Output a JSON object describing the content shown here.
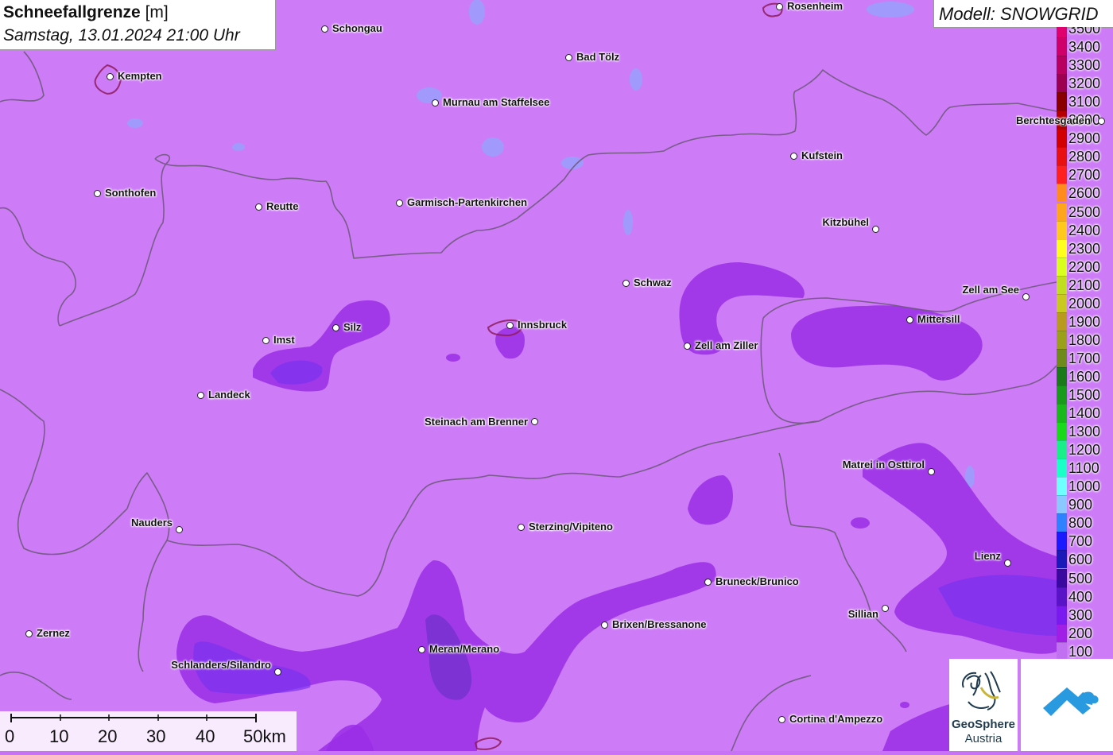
{
  "header": {
    "title_bold": "Schneefallgrenze",
    "title_unit": "[m]",
    "datetime": "Samstag, 13.01.2024 21:00 Uhr"
  },
  "model": {
    "label": "Modell: SNOWGRID"
  },
  "legend": {
    "items": [
      {
        "value": "3500",
        "color": "#e0006e"
      },
      {
        "value": "3400",
        "color": "#d0006a"
      },
      {
        "value": "3300",
        "color": "#b80060"
      },
      {
        "value": "3200",
        "color": "#9c0050"
      },
      {
        "value": "3100",
        "color": "#8a0000"
      },
      {
        "value": "3000",
        "color": "#b40000"
      },
      {
        "value": "2900",
        "color": "#d20000"
      },
      {
        "value": "2800",
        "color": "#e81010"
      },
      {
        "value": "2700",
        "color": "#ff2020"
      },
      {
        "value": "2600",
        "color": "#ff8a1e"
      },
      {
        "value": "2500",
        "color": "#ffa51c"
      },
      {
        "value": "2400",
        "color": "#ffc81c"
      },
      {
        "value": "2300",
        "color": "#ffff1e"
      },
      {
        "value": "2200",
        "color": "#d8ff1e"
      },
      {
        "value": "2100",
        "color": "#c0de1e"
      },
      {
        "value": "2000",
        "color": "#c8c81e"
      },
      {
        "value": "1900",
        "color": "#b89a1e"
      },
      {
        "value": "1800",
        "color": "#9aa01a"
      },
      {
        "value": "1700",
        "color": "#6e8a1a"
      },
      {
        "value": "1600",
        "color": "#1a7a1a"
      },
      {
        "value": "1500",
        "color": "#1a9a1a"
      },
      {
        "value": "1400",
        "color": "#1ab81a"
      },
      {
        "value": "1300",
        "color": "#1ad81a"
      },
      {
        "value": "1200",
        "color": "#1aee8a"
      },
      {
        "value": "1100",
        "color": "#1affc8"
      },
      {
        "value": "1000",
        "color": "#6effff"
      },
      {
        "value": "900",
        "color": "#8ac8ff"
      },
      {
        "value": "800",
        "color": "#2e82ff"
      },
      {
        "value": "700",
        "color": "#1a1aff"
      },
      {
        "value": "600",
        "color": "#1a1ab8"
      },
      {
        "value": "500",
        "color": "#3a0aa0"
      },
      {
        "value": "400",
        "color": "#5a14c8"
      },
      {
        "value": "300",
        "color": "#7a1af0"
      },
      {
        "value": "200",
        "color": "#a01ee6"
      },
      {
        "value": "100",
        "color": "#c070f0"
      }
    ]
  },
  "cities": [
    {
      "name": "Schongau"
    },
    {
      "name": "Rosenheim"
    },
    {
      "name": "Bad Tölz"
    },
    {
      "name": "Kempten"
    },
    {
      "name": "Murnau am Staffelsee"
    },
    {
      "name": "Berchtesgaden"
    },
    {
      "name": "Kufstein"
    },
    {
      "name": "Sonthofen"
    },
    {
      "name": "Reutte"
    },
    {
      "name": "Garmisch-Partenkirchen"
    },
    {
      "name": "Kitzbühel"
    },
    {
      "name": "Schwaz"
    },
    {
      "name": "Zell am See"
    },
    {
      "name": "Mittersill"
    },
    {
      "name": "Innsbruck"
    },
    {
      "name": "Silz"
    },
    {
      "name": "Imst"
    },
    {
      "name": "Zell am Ziller"
    },
    {
      "name": "Landeck"
    },
    {
      "name": "Steinach am Brenner"
    },
    {
      "name": "Matrei in Osttirol"
    },
    {
      "name": "Nauders"
    },
    {
      "name": "Sterzing/Vipiteno"
    },
    {
      "name": "Lienz"
    },
    {
      "name": "Bruneck/Brunico"
    },
    {
      "name": "Sillian"
    },
    {
      "name": "Brixen/Bressanone"
    },
    {
      "name": "Zernez"
    },
    {
      "name": "Meran/Merano"
    },
    {
      "name": "Schlanders/Silandro"
    },
    {
      "name": "Cortina d'Ampezzo"
    }
  ],
  "scale": {
    "labels": [
      "0",
      "10",
      "20",
      "30",
      "40",
      "50km"
    ]
  },
  "logos": {
    "geosphere_line1": "GeoSphere",
    "geosphere_line2": "Austria"
  }
}
